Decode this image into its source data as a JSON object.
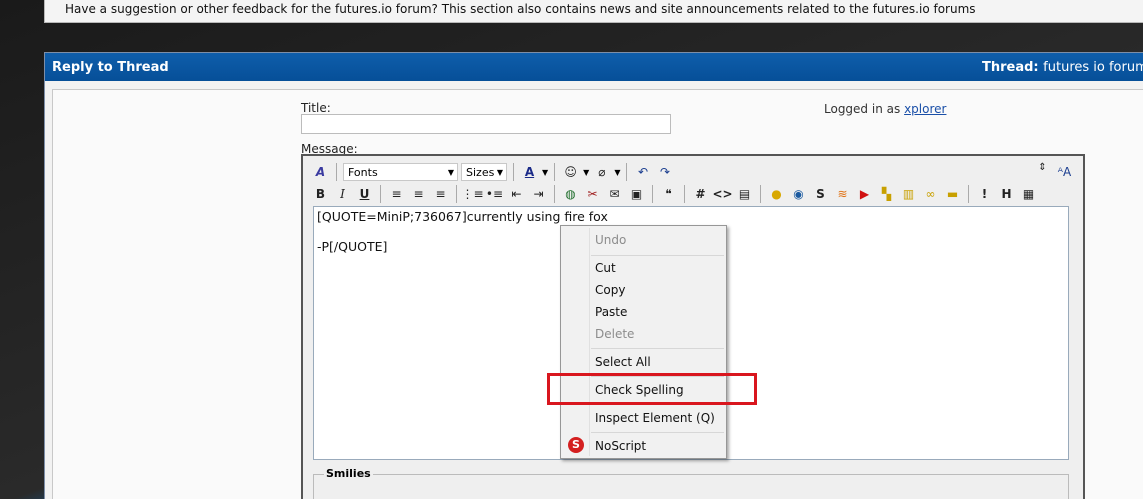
{
  "banner": {
    "text": "Have a suggestion or other feedback for the futures.io forum? This section also contains news and site announcements related to the futures.io forums"
  },
  "panel": {
    "title": "Reply to Thread",
    "thread_label": "Thread:",
    "thread_value": "futures io forum ch"
  },
  "form": {
    "title_label": "Title:",
    "title_value": "",
    "logged_prefix": "Logged in as",
    "logged_user": "xplorer",
    "message_label": "Message:"
  },
  "toolbar": {
    "fonts": "Fonts",
    "sizes": "Sizes"
  },
  "editor": {
    "line1": "[QUOTE=MiniP;736067]currently using fire fox",
    "line2": "-P[/QUOTE]"
  },
  "smilies_label": "Smilies",
  "context_menu": {
    "undo": "Undo",
    "cut": "Cut",
    "copy": "Copy",
    "paste": "Paste",
    "delete": "Delete",
    "select_all": "Select All",
    "check_spelling": "Check Spelling",
    "inspect": "Inspect Element (Q)",
    "noscript": "NoScript"
  },
  "colors": {
    "header": "#0a56a2",
    "highlight": "#d9161e"
  }
}
